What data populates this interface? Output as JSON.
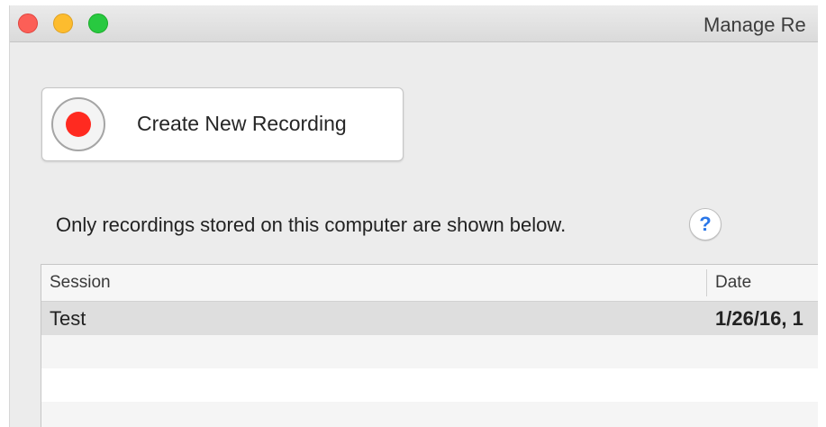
{
  "window": {
    "title": "Manage Re"
  },
  "create_button": {
    "label": "Create New Recording",
    "icon": "record-icon",
    "icon_color": "#ff2a20"
  },
  "info": {
    "text": "Only recordings stored on this computer are shown below.",
    "help_glyph": "?"
  },
  "table": {
    "columns": [
      "Session",
      "Date"
    ],
    "rows": [
      {
        "session": "Test",
        "date": "1/26/16, 1"
      }
    ]
  }
}
